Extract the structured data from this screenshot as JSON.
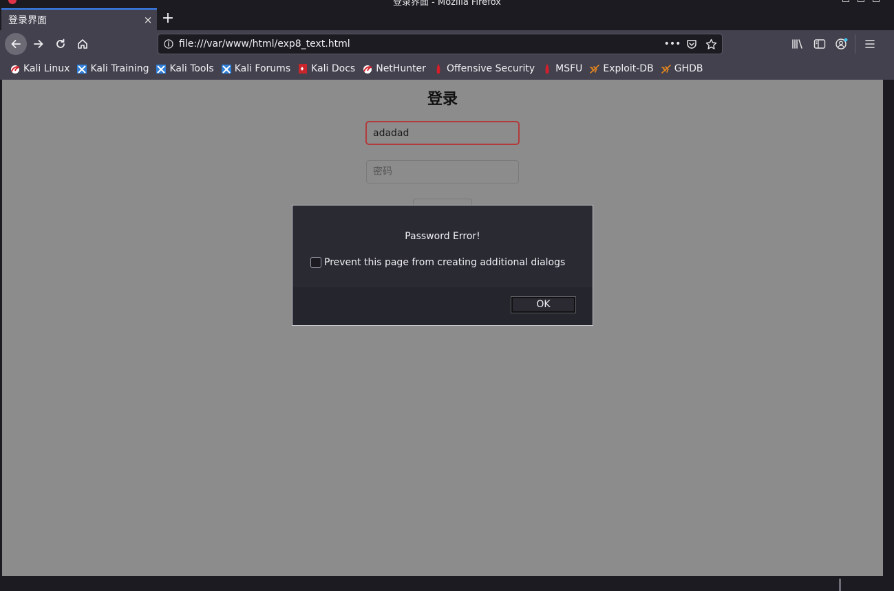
{
  "window": {
    "title": "登录界面 - Mozilla Firefox"
  },
  "tab": {
    "title": "登录界面",
    "close": "×",
    "new_tab": "+"
  },
  "urlbar": {
    "url": "file:///var/www/html/exp8_text.html",
    "more": "•••"
  },
  "bookmarks": [
    {
      "label": "Kali Linux",
      "icon": "kali-dragon-icon"
    },
    {
      "label": "Kali Training",
      "icon": "kali-training-icon"
    },
    {
      "label": "Kali Tools",
      "icon": "kali-tools-icon"
    },
    {
      "label": "Kali Forums",
      "icon": "kali-forums-icon"
    },
    {
      "label": "Kali Docs",
      "icon": "kali-docs-icon"
    },
    {
      "label": "NetHunter",
      "icon": "kali-dragon-icon"
    },
    {
      "label": "Offensive Security",
      "icon": "offsec-icon"
    },
    {
      "label": "MSFU",
      "icon": "offsec-icon"
    },
    {
      "label": "Exploit-DB",
      "icon": "exploitdb-spider-icon"
    },
    {
      "label": "GHDB",
      "icon": "exploitdb-spider-icon"
    }
  ],
  "page": {
    "heading": "登录",
    "username_value": "adadad",
    "password_placeholder": "密码"
  },
  "dialog": {
    "message": "Password Error!",
    "checkbox_label": "Prevent this page from creating additional dialogs",
    "ok_label": "OK"
  },
  "colors": {
    "accent": "#3b82f6",
    "toolbar": "#42414d",
    "frame": "#1c1b22",
    "content_dimmed": "#8c8c8c",
    "error_border": "#b23a3a"
  }
}
